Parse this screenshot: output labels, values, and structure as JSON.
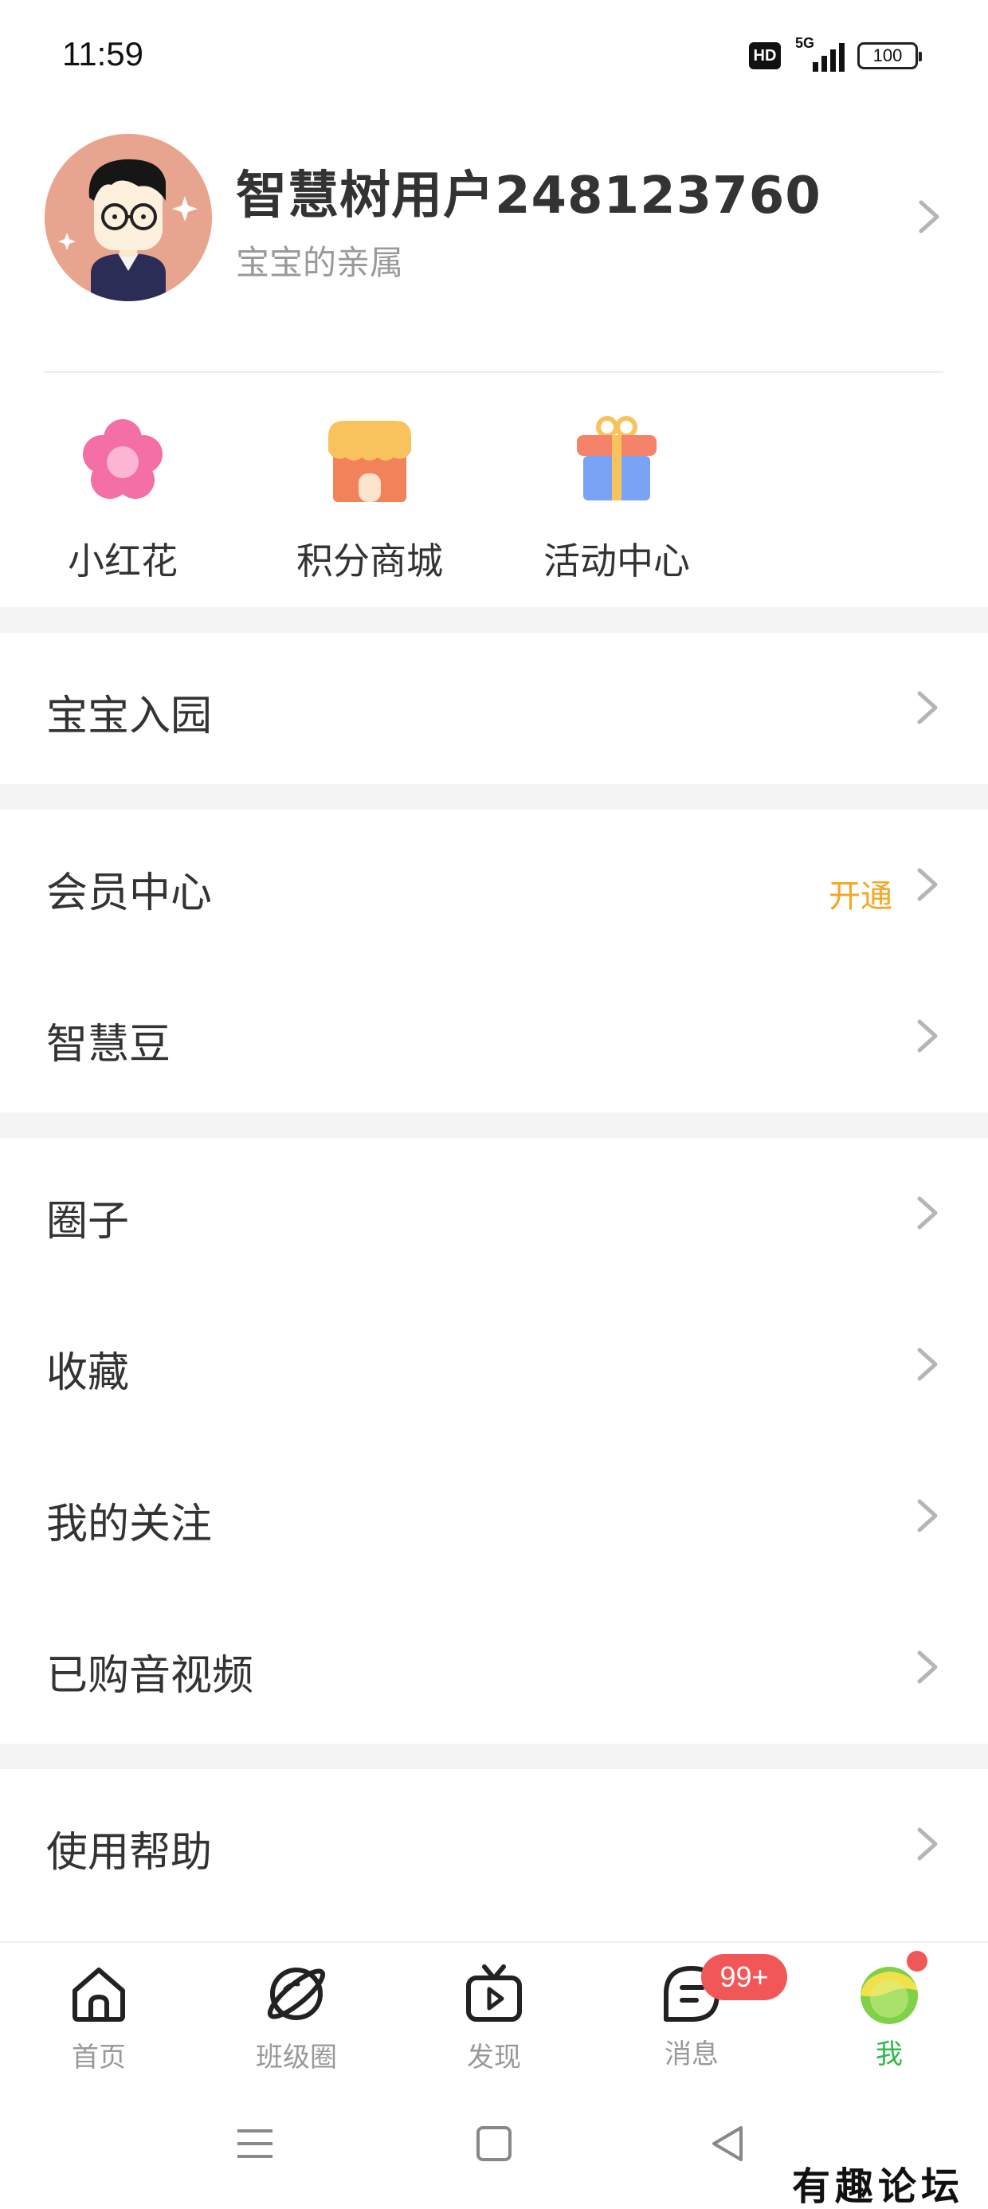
{
  "status_bar": {
    "time": "11:59",
    "hd": "HD",
    "network": "5G",
    "battery": "100"
  },
  "profile": {
    "name": "智慧树用户248123760",
    "subtitle": "宝宝的亲属"
  },
  "quick_actions": [
    {
      "label": "小红花",
      "icon": "flower-icon"
    },
    {
      "label": "积分商城",
      "icon": "shop-icon"
    },
    {
      "label": "活动中心",
      "icon": "gift-icon"
    }
  ],
  "menu": {
    "enroll": "宝宝入园",
    "member_center": "会员中心",
    "member_action": "开通",
    "wisdom_beans": "智慧豆",
    "circle": "圈子",
    "favorites": "收藏",
    "following": "我的关注",
    "purchased_media": "已购音视频",
    "help": "使用帮助"
  },
  "bottom_nav": {
    "home": "首页",
    "class_circle": "班级圈",
    "discover": "发现",
    "messages": "消息",
    "messages_badge": "99+",
    "me": "我"
  },
  "watermark": "有趣论坛",
  "colors": {
    "accent_green": "#2eb84a",
    "badge_red": "#f25757",
    "member_orange": "#f5a623"
  }
}
